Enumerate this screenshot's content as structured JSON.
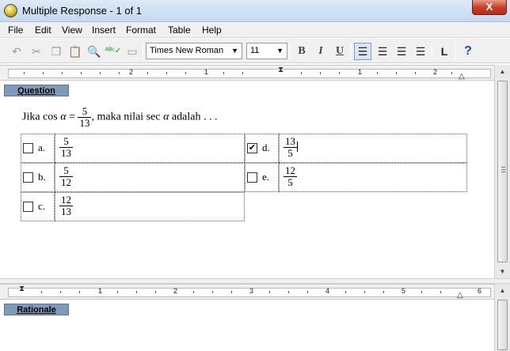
{
  "window": {
    "title": "Multiple Response - 1 of 1",
    "close_glyph": "X"
  },
  "menu": [
    "File",
    "Edit",
    "View",
    "Insert",
    "Format",
    "Table",
    "Help"
  ],
  "toolbar": {
    "font_name": "Times New Roman",
    "font_size": "11",
    "bold": "B",
    "italic": "I",
    "underline": "U",
    "help": "?"
  },
  "ruler_top": {
    "labels": [
      "2",
      "1",
      "1",
      "2"
    ]
  },
  "ruler_bottom": {
    "labels": [
      "1",
      "2",
      "3",
      "4",
      "5",
      "6"
    ]
  },
  "sections": {
    "question": "Question",
    "rationale": "Rationale"
  },
  "question": {
    "prefix": "Jika cos ",
    "alpha": "α",
    "equals": " = ",
    "frac_num": "5",
    "frac_den": "13",
    "middle": ", maka nilai sec ",
    "suffix": " adalah . . ."
  },
  "answers": [
    {
      "letter": "a.",
      "num": "5",
      "den": "13",
      "checked": false
    },
    {
      "letter": "b.",
      "num": "5",
      "den": "12",
      "checked": false
    },
    {
      "letter": "c.",
      "num": "12",
      "den": "13",
      "checked": false
    },
    {
      "letter": "d.",
      "num": "13",
      "den": "5",
      "checked": true
    },
    {
      "letter": "e.",
      "num": "12",
      "den": "5",
      "checked": false
    }
  ],
  "check_glyph": "✔"
}
